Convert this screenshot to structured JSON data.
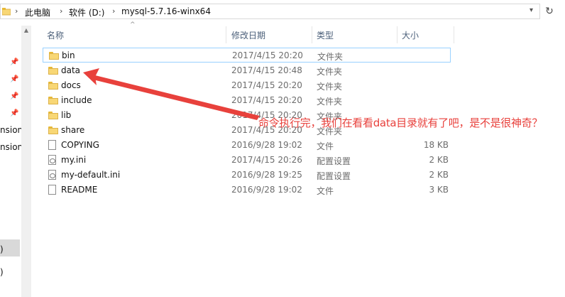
{
  "address_bar": {
    "crumbs": [
      "此电脑",
      "软件 (D:)",
      "mysql-5.7.16-winx64"
    ]
  },
  "nav_pane": {
    "clipped_items": [
      "nsion",
      "nsion",
      ")",
      ")"
    ]
  },
  "columns": {
    "name": "名称",
    "date": "修改日期",
    "type": "类型",
    "size": "大小"
  },
  "files": [
    {
      "name": "bin",
      "date": "2017/4/15 20:20",
      "type": "文件夹",
      "size": "",
      "icon": "folder-icon"
    },
    {
      "name": "data",
      "date": "2017/4/15 20:48",
      "type": "文件夹",
      "size": "",
      "icon": "folder-icon"
    },
    {
      "name": "docs",
      "date": "2017/4/15 20:20",
      "type": "文件夹",
      "size": "",
      "icon": "folder-icon"
    },
    {
      "name": "include",
      "date": "2017/4/15 20:20",
      "type": "文件夹",
      "size": "",
      "icon": "folder-icon"
    },
    {
      "name": "lib",
      "date": "2017/4/15 20:20",
      "type": "文件夹",
      "size": "",
      "icon": "folder-icon"
    },
    {
      "name": "share",
      "date": "2017/4/15 20:20",
      "type": "文件夹",
      "size": "",
      "icon": "folder-icon"
    },
    {
      "name": "COPYING",
      "date": "2016/9/28 19:02",
      "type": "文件",
      "size": "18 KB",
      "icon": "file-icon"
    },
    {
      "name": "my.ini",
      "date": "2017/4/15 20:26",
      "type": "配置设置",
      "size": "2 KB",
      "icon": "ini-file-icon"
    },
    {
      "name": "my-default.ini",
      "date": "2016/9/28 19:25",
      "type": "配置设置",
      "size": "2 KB",
      "icon": "ini-file-icon"
    },
    {
      "name": "README",
      "date": "2016/9/28 19:02",
      "type": "文件",
      "size": "3 KB",
      "icon": "file-icon"
    }
  ],
  "annotation": {
    "text": "命令执行完，我们在看看data目录就有了吧，是不是很神奇？",
    "color": "#e8413c"
  },
  "colors": {
    "header_text": "#4c607a",
    "selection_border": "#99d1ff",
    "folder": "#f8d775"
  }
}
